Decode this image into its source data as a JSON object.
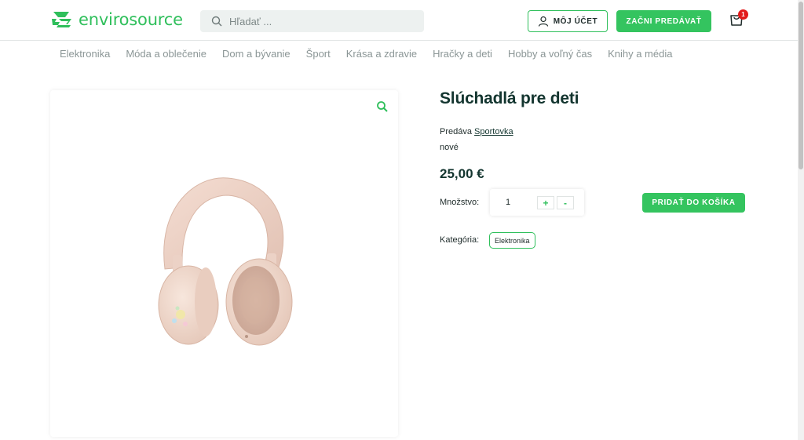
{
  "header": {
    "logo_text": "envirosource",
    "search_placeholder": "Hľadať ...",
    "account_label": "MÔJ ÚČET",
    "sell_label": "ZAČNI PREDÁVAŤ",
    "cart_count": "1"
  },
  "nav": {
    "categories": [
      "Elektronika",
      "Móda a oblečenie",
      "Dom a bývanie",
      "Šport",
      "Krása a zdravie",
      "Hračky a deti",
      "Hobby a voľný čas",
      "Knihy a média"
    ]
  },
  "product": {
    "title": "Slúchadlá pre deti",
    "seller_prefix": "Predáva",
    "seller_name": "Sportovka",
    "condition": "nové",
    "price": "25,00 €",
    "quantity_label": "Množstvo:",
    "quantity": "1",
    "plus_label": "+",
    "minus_label": "-",
    "add_to_cart_label": "PRIDAŤ DO KOŠÍKA",
    "category_label": "Kategória:",
    "category_tag": "Elektronika",
    "image_subject": "headphones-image"
  },
  "colors": {
    "brand_green": "#34c45f",
    "title_dark": "#13352f",
    "badge_red": "#e21b1b"
  }
}
